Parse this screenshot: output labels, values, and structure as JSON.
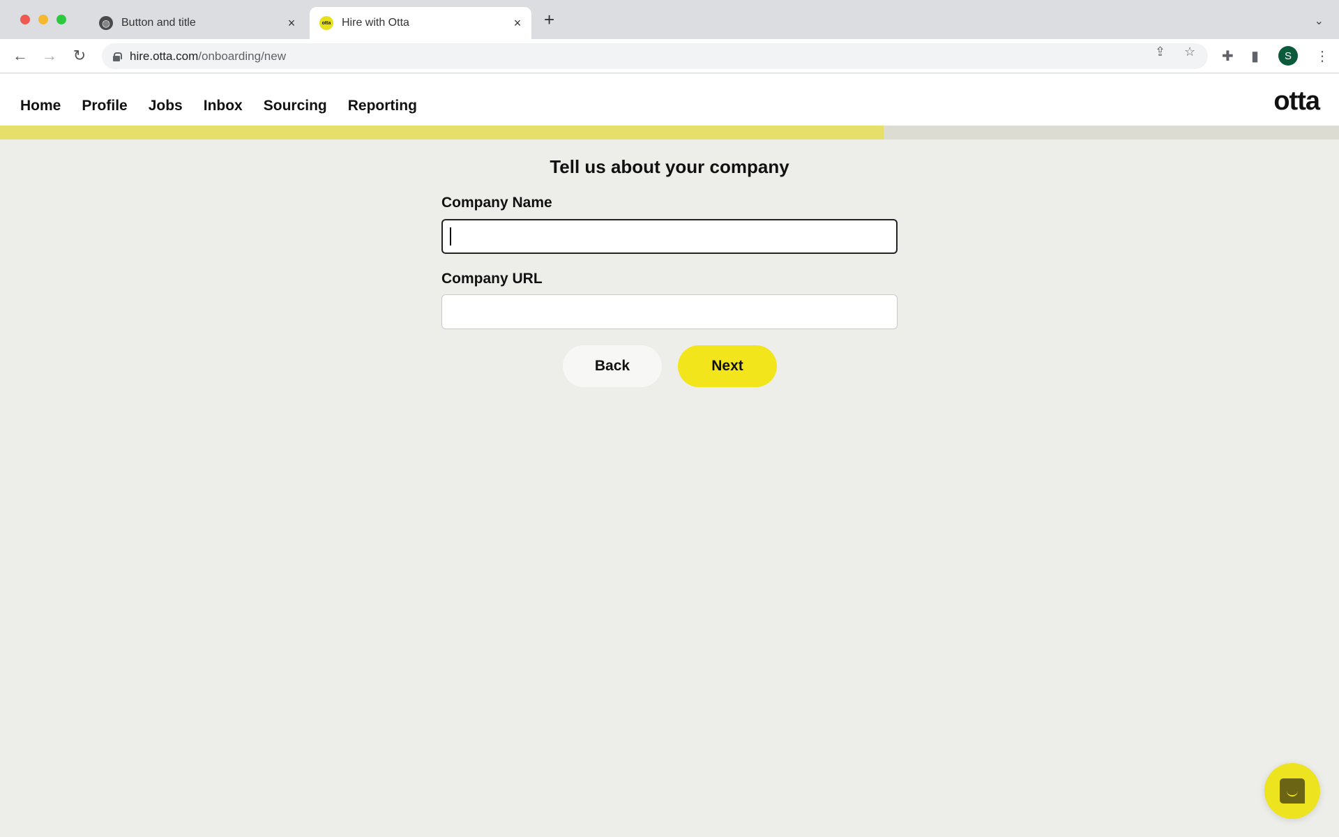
{
  "browser": {
    "tabs": [
      {
        "title": "Button and title",
        "icon": "globe-icon",
        "active": false
      },
      {
        "title": "Hire with Otta",
        "icon": "otta-favicon",
        "favicon_text": "otta",
        "active": true
      }
    ],
    "new_tab_glyph": "+",
    "close_glyph": "×",
    "url_host": "hire.otta.com",
    "url_path": "/onboarding/new",
    "profile_initial": "S"
  },
  "app": {
    "nav": [
      "Home",
      "Profile",
      "Jobs",
      "Inbox",
      "Sourcing",
      "Reporting"
    ],
    "logo": "otta",
    "progress_percent": 66,
    "accent_color": "#f2e51c"
  },
  "form": {
    "heading": "Tell us about your company",
    "company_name": {
      "label": "Company Name",
      "value": "",
      "placeholder": ""
    },
    "company_url": {
      "label": "Company URL",
      "value": "",
      "placeholder": ""
    },
    "back_label": "Back",
    "next_label": "Next"
  }
}
